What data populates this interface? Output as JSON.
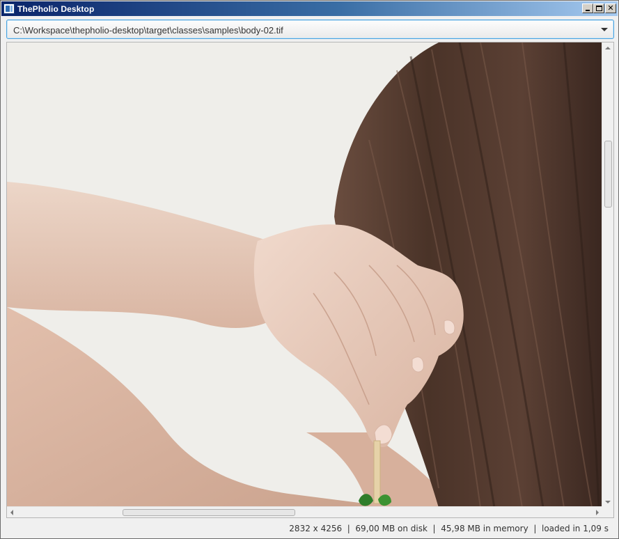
{
  "window": {
    "title": "ThePholio Desktop"
  },
  "path_combo": {
    "value": "C:\\Workspace\\thepholio-desktop\\target\\classes\\samples\\body-02.tif"
  },
  "image": {
    "description_icon": "photo-image",
    "colors": {
      "background": "#efeeea",
      "skin": "#e7cdbd",
      "hair": "#4a3328"
    }
  },
  "status": {
    "dimensions": "2832 x 4256",
    "disk": "69,00 MB on disk",
    "memory": "45,98 MB in memory",
    "load_time": "loaded in 1,09 s",
    "separator": "  |  "
  },
  "scrollbars": {
    "vertical_position": 0.2,
    "horizontal_position": 0.19
  }
}
